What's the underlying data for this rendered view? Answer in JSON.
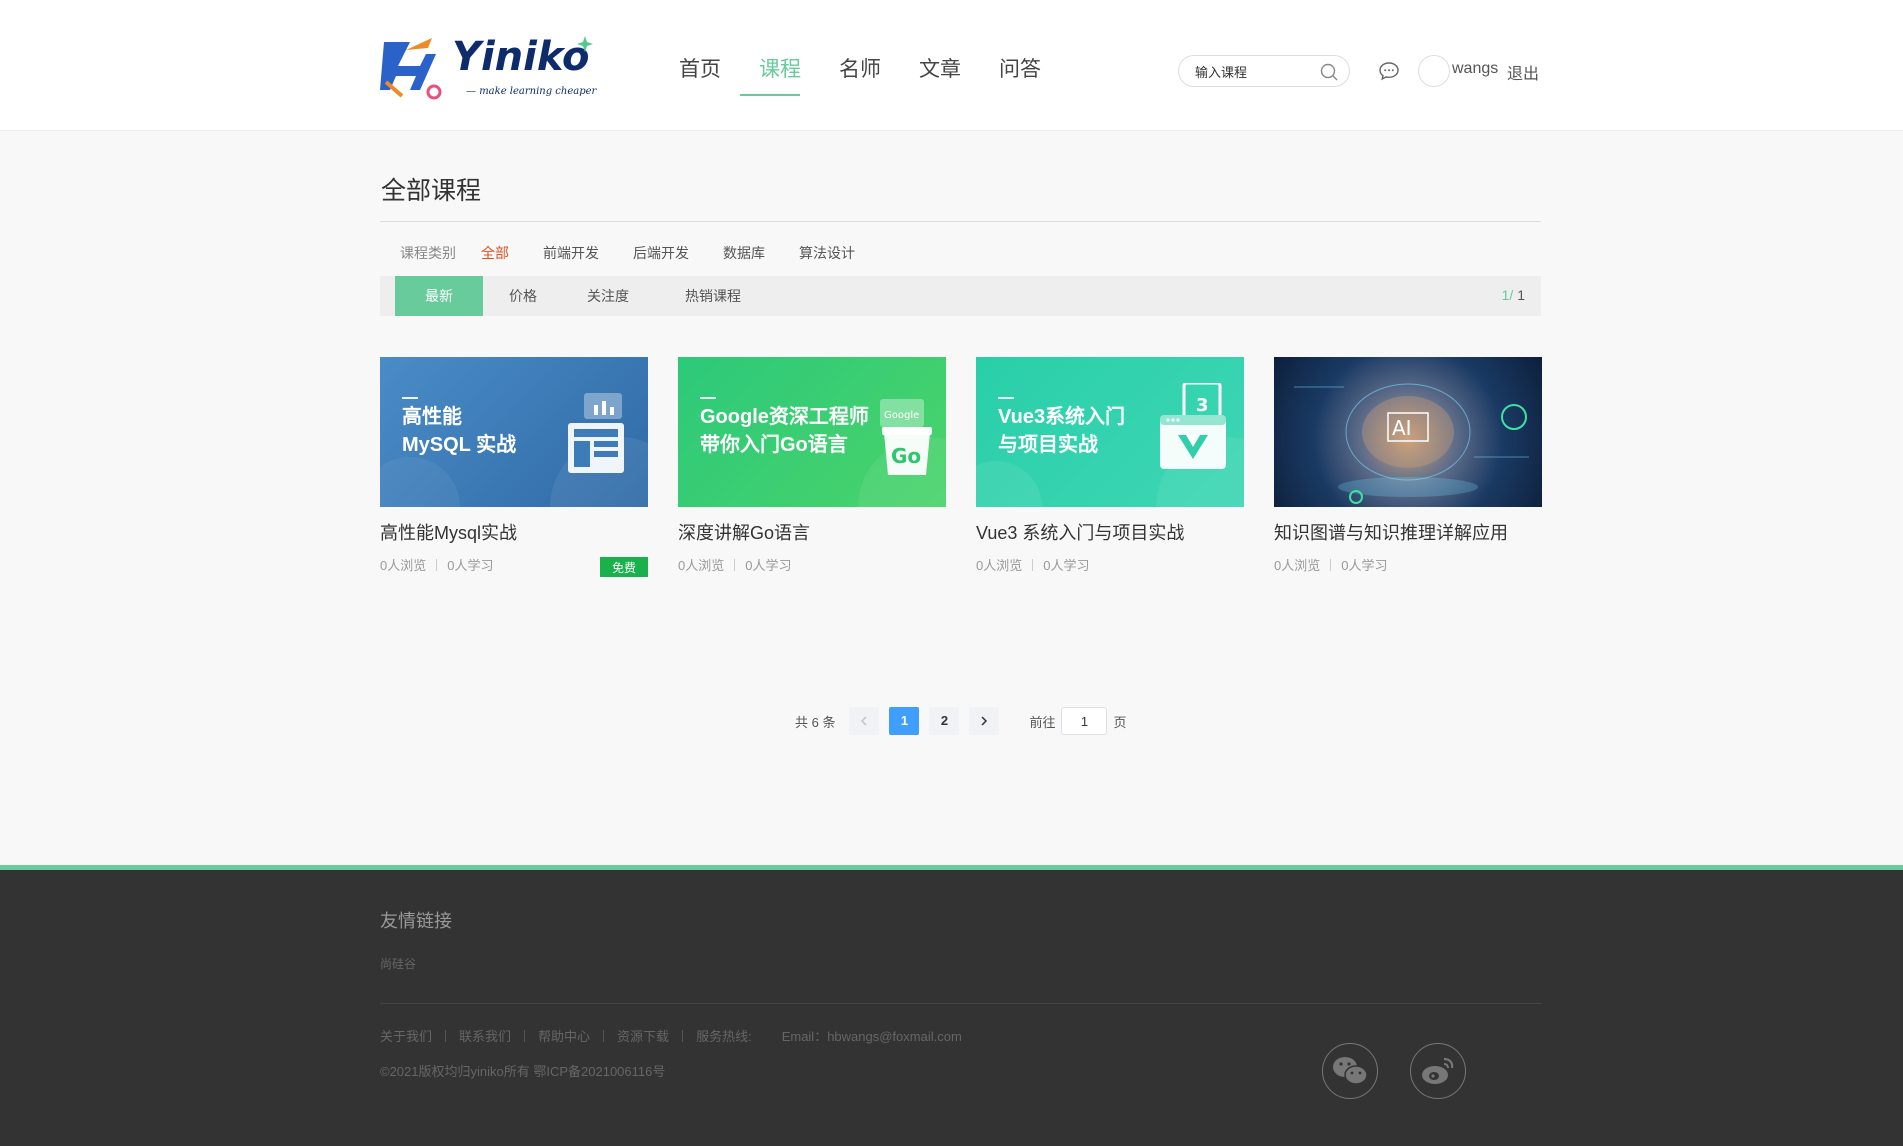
{
  "brand": {
    "name": "Yiniko",
    "slogan": "make learning cheaper"
  },
  "nav": [
    {
      "label": "首页",
      "active": false
    },
    {
      "label": "课程",
      "active": true
    },
    {
      "label": "名师",
      "active": false
    },
    {
      "label": "文章",
      "active": false
    },
    {
      "label": "问答",
      "active": false
    }
  ],
  "search": {
    "placeholder": "输入课程",
    "value": ""
  },
  "user": {
    "name": "wangs",
    "logout_label": "退出"
  },
  "page_title": "全部课程",
  "categories": {
    "label": "课程类别",
    "items": [
      {
        "label": "全部",
        "active": true
      },
      {
        "label": "前端开发",
        "active": false
      },
      {
        "label": "后端开发",
        "active": false
      },
      {
        "label": "数据库",
        "active": false
      },
      {
        "label": "算法设计",
        "active": false
      }
    ]
  },
  "sort": {
    "items": [
      {
        "label": "最新",
        "active": true
      },
      {
        "label": "价格",
        "active": false
      },
      {
        "label": "关注度",
        "active": false
      },
      {
        "label": "热销课程",
        "active": false
      }
    ],
    "page_current": "1",
    "page_total": "1"
  },
  "courses": [
    {
      "title": "高性能Mysql实战",
      "cover_text": "高性能\nMySQL 实战",
      "views": "0人浏览",
      "learners": "0人学习",
      "badge": "免费",
      "cover_color": "#3d7cb9"
    },
    {
      "title": "深度讲解Go语言",
      "cover_text": "Google资深工程师\n带你入门Go语言",
      "views": "0人浏览",
      "learners": "0人学习",
      "badge": "",
      "cover_color": "#2fc66f",
      "cover_tag": "Google",
      "cover_art": "Go"
    },
    {
      "title": "Vue3 系统入门与项目实战",
      "cover_text": "Vue3系统入门\n与项目实战",
      "views": "0人浏览",
      "learners": "0人学习",
      "badge": "",
      "cover_color": "#2fcfaa",
      "cover_art": "3"
    },
    {
      "title": "知识图谱与知识推理详解应用",
      "cover_text": "",
      "views": "0人浏览",
      "learners": "0人学习",
      "badge": "",
      "cover_color": "#14305a",
      "cover_art": "AI"
    }
  ],
  "pagination": {
    "total_text": "共 6 条",
    "prev_icon": "chevron-left-icon",
    "pages": [
      "1",
      "2"
    ],
    "active_page": "1",
    "next_icon": "chevron-right-icon",
    "goto_label": "前往",
    "goto_value": "1",
    "page_unit": "页"
  },
  "footer": {
    "friend_title": "友情链接",
    "friend_links": [
      "尚硅谷"
    ],
    "links": [
      "关于我们",
      "联系我们",
      "帮助中心",
      "资源下载",
      "服务热线:"
    ],
    "email": "Email：hbwangs@foxmail.com",
    "copyright": "©2021版权均归yiniko所有 鄂ICP备2021006116号",
    "social_icons": [
      "wechat-icon",
      "weibo-icon"
    ]
  },
  "colors": {
    "accent": "#68cb9b",
    "category_active": "#e6511f",
    "pager_active": "#409eff",
    "badge": "#19b14b",
    "footer_bg": "#333333"
  }
}
